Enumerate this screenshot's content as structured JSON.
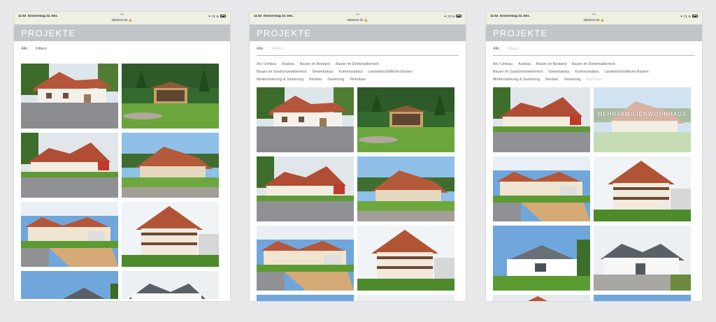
{
  "screens": [
    {
      "time": "11:53",
      "date": "Donnerstag 23. Dez.",
      "url": "abkaiser.de",
      "battery": "72 %"
    },
    {
      "time": "11:54",
      "date": "Donnerstag 23. Dez.",
      "url": "abkaiser.de",
      "battery": "72 %"
    },
    {
      "time": "11:54",
      "date": "Donnerstag 23. Dez.",
      "url": "abkaiser.de",
      "battery": "71 %"
    }
  ],
  "header": {
    "title": "PROJEKTE"
  },
  "filter": {
    "all_label": "Alle",
    "filter_label": "Filtern"
  },
  "categories": [
    "An-/ Umbau",
    "Ausbau",
    "Bauen im Bestand",
    "Bauen im Denkmalbereich",
    "Bauen im Gastronomiebereich",
    "Gewerbebau",
    "Kommunalbau",
    "Landwirtschaftliche Bauten",
    "Modernisierung & Sanierung",
    "Neubau",
    "Sanierung",
    "Wohnbau"
  ],
  "overlay": {
    "text": "MEHRFAMILIENWOHNHAUS"
  },
  "colors": {
    "header_bg": "#c1c5c8",
    "accent_roof": "#b5553a",
    "grass": "#5c9a32",
    "sky": "#8ec0e8"
  }
}
